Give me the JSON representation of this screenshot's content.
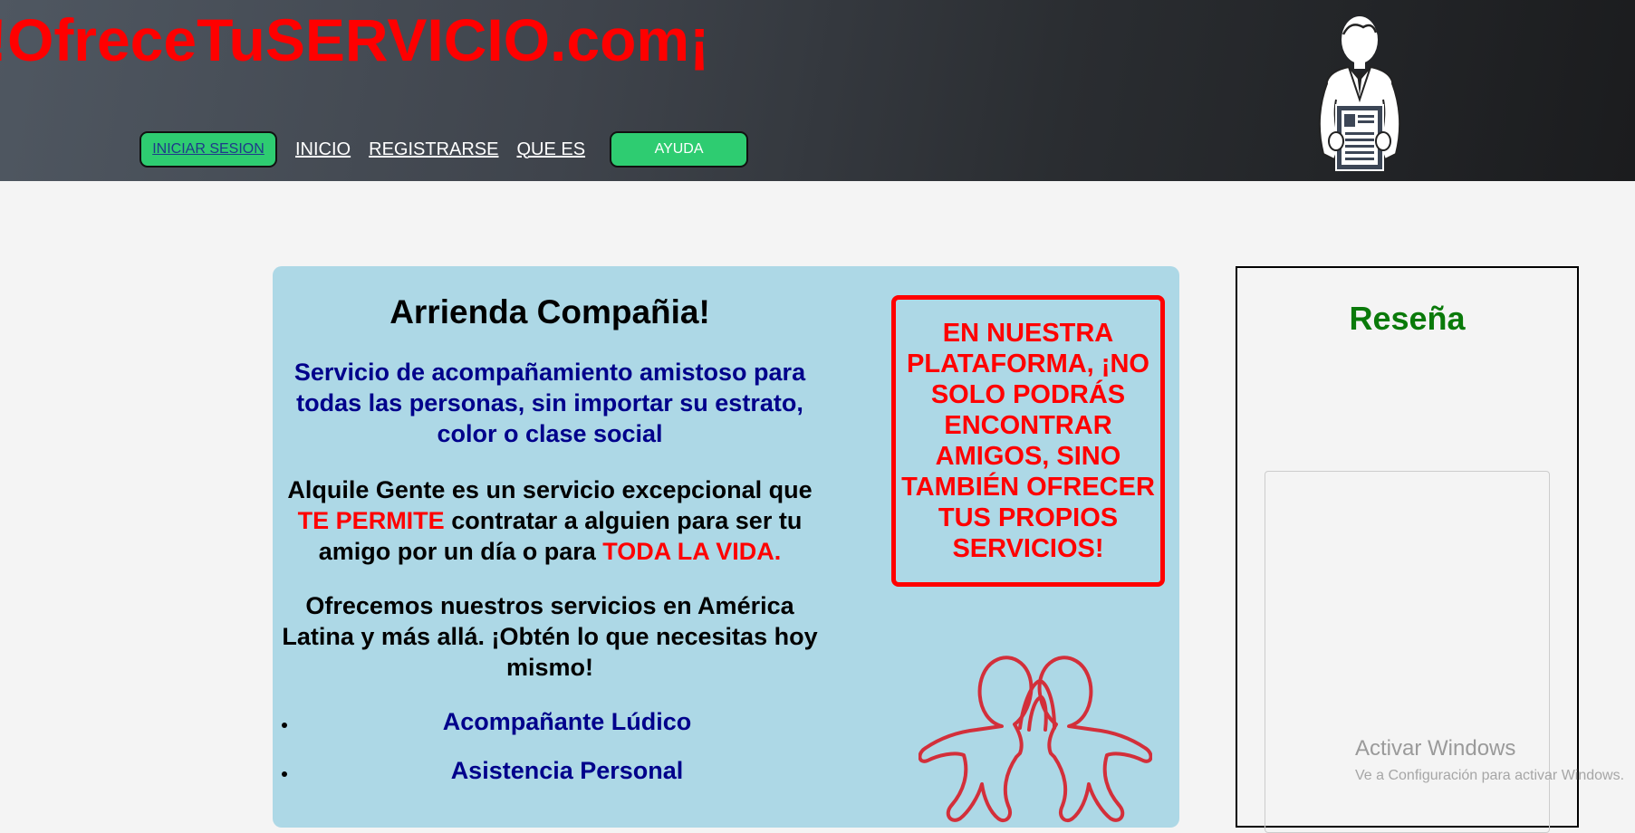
{
  "header": {
    "site_title": "!OfreceTuSERVICIO.com¡",
    "nav": {
      "login_label": "INICIAR SESION",
      "links": [
        "INICIO",
        "REGISTRARSE",
        "QUE ES"
      ],
      "help_label": "AYUDA"
    },
    "figure_icon": "businessman-with-cv-icon"
  },
  "main": {
    "heading": "Arrienda Compañia!",
    "subtitle": "Servicio de acompañamiento amistoso para todas las personas, sin importar su estrato, color o clase social",
    "paragraph1": {
      "part1": "Alquile Gente es un servicio excepcional que ",
      "highlight1": "TE PERMITE",
      "part2": " contratar a alguien para ser tu amigo por un día o para ",
      "highlight2": "TODA LA VIDA."
    },
    "paragraph2": "Ofrecemos nuestros servicios en América Latina y más allá. ¡Obtén lo que necesitas hoy mismo!",
    "services": [
      "Acompañante Lúdico",
      "Asistencia Personal"
    ],
    "promo_text": "EN NUESTRA PLATAFORMA, ¡NO SOLO PODRÁS ENCONTRAR AMIGOS, SINO TAMBIÉN OFRECER TUS PROPIOS SERVICIOS!",
    "friends_icon": "friends-hug-icon"
  },
  "review": {
    "title": "Reseña"
  },
  "watermark": {
    "line1": "Activar Windows",
    "line2": "Ve a Configuración para activar Windows."
  },
  "colors": {
    "brand_red": "#ff0000",
    "nav_green": "#2ecc71",
    "main_bg": "#add8e6",
    "navy": "#00008b",
    "review_green": "#0a7a0a"
  }
}
